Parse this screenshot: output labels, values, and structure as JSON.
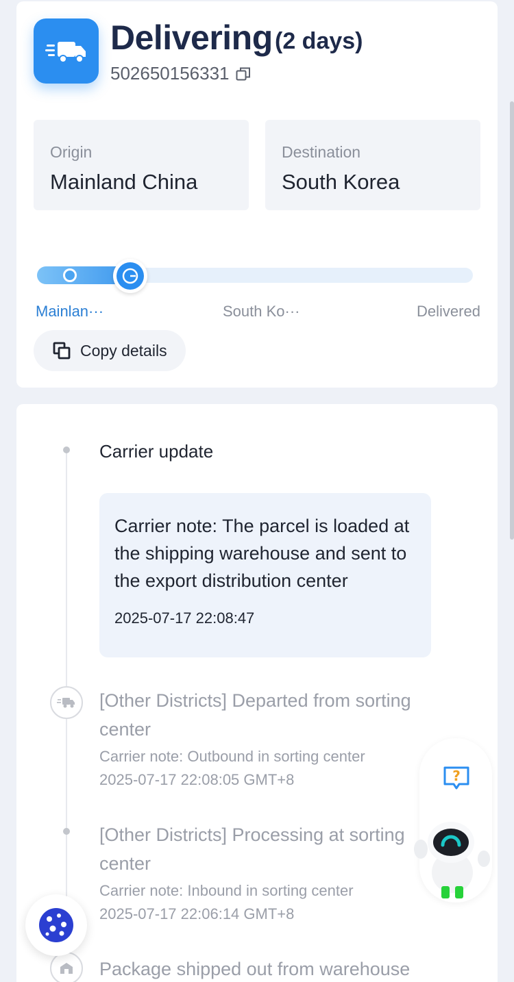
{
  "header": {
    "status": "Delivering",
    "days": "(2 days)",
    "tracking_number": "502650156331"
  },
  "route": {
    "origin_label": "Origin",
    "origin_value": "Mainland China",
    "destination_label": "Destination",
    "destination_value": "South Korea"
  },
  "progress": {
    "steps": [
      "Mainlan···",
      "South Ko···",
      "Delivered"
    ],
    "current_step": 1
  },
  "actions": {
    "copy_details": "Copy details"
  },
  "timeline": {
    "latest": {
      "title": "Carrier update",
      "note": "Carrier note: The parcel is loaded at the shipping warehouse and sent to the export distribution center",
      "time": "2025-07-17 22:08:47"
    },
    "events": [
      {
        "title": "[Other Districts] Departed from sorting center",
        "note": "Carrier note: Outbound in sorting center",
        "time": "2025-07-17 22:08:05 GMT+8"
      },
      {
        "title": "[Other Districts] Processing at sorting center",
        "note": "Carrier note: Inbound in sorting center",
        "time": "2025-07-17 22:06:14 GMT+8"
      },
      {
        "title": "Package shipped out from warehouse",
        "note": "",
        "time": ""
      }
    ]
  },
  "colors": {
    "accent": "#2b8ef0",
    "text_primary": "#1f2430",
    "text_muted": "#9a9ea8"
  },
  "icons": [
    "truck-icon",
    "copy-icon",
    "cookie-icon",
    "help-icon",
    "robot-mascot"
  ]
}
